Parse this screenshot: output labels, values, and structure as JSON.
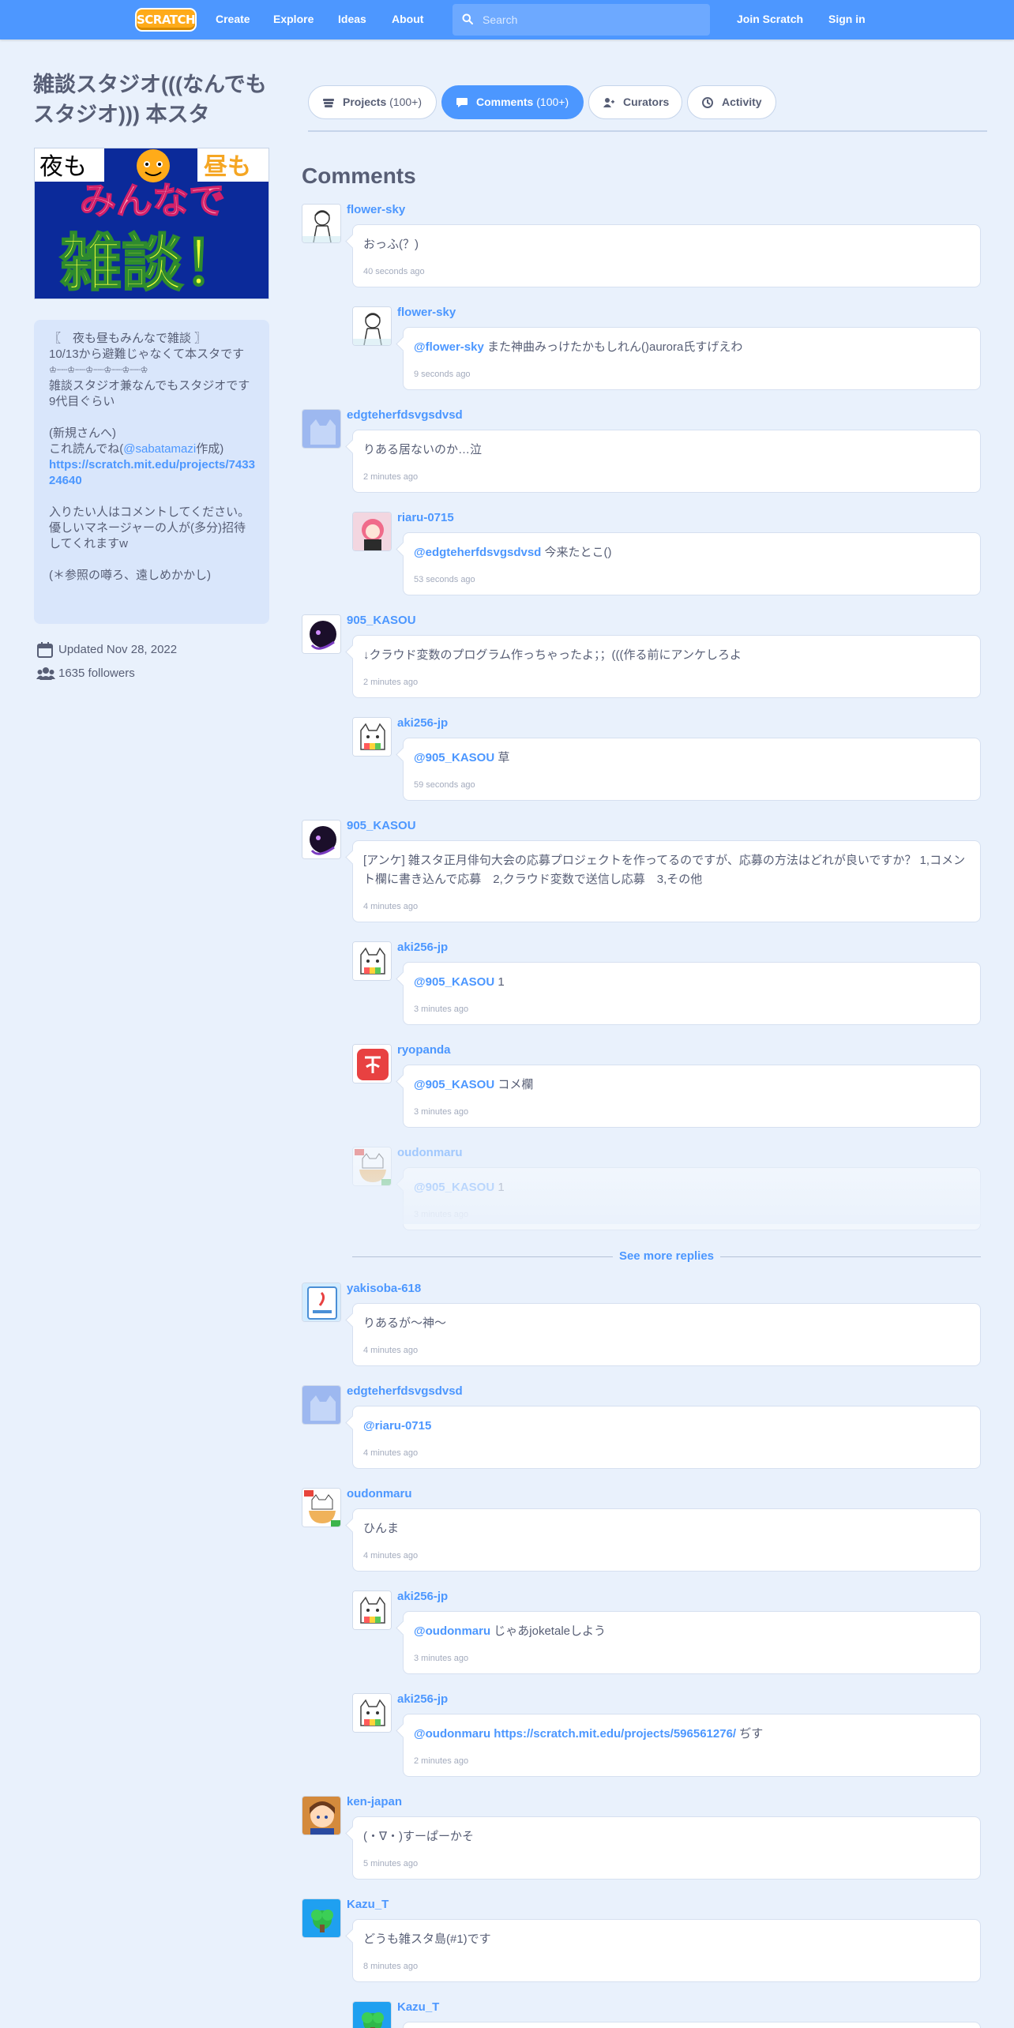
{
  "nav": {
    "logo": "SCRATCH",
    "links": [
      "Create",
      "Explore",
      "Ideas",
      "About"
    ],
    "search_placeholder": "Search",
    "join": "Join Scratch",
    "signin": "Sign in"
  },
  "studio": {
    "title": "雑談スタジオ(((なんでもスタジオ))) 本スタ",
    "thumbnail": {
      "top_left": "夜も",
      "top_right": "昼も",
      "middle": "みんなで",
      "bottom": "雑談！"
    },
    "description_lines": [
      "〖　夜も昼もみんなで雑談 〗",
      "10/13から避難じゃなくて本スタです",
      "♔┈┈♔┈┈♔┈┈♔┈┈♔┈┈♔",
      "雑談スタジオ兼なんでもスタジオです",
      "9代目ぐらい",
      "",
      "(新規さんへ)"
    ],
    "description_read_pre": "これ読んでね(",
    "description_read_mention": "@sabatamazi",
    "description_read_post": "作成)",
    "description_link": "https://scratch.mit.edu/projects/743324640",
    "description_lines_after": [
      "",
      "入りたい人はコメントしてください。",
      "優しいマネージャーの人が(多分)招待してくれますw",
      "",
      "(＊参照の噂ろ、遠しめかかし)"
    ],
    "updated": "Updated Nov 28, 2022",
    "followers": "1635 followers"
  },
  "tabs": [
    {
      "label": "Projects",
      "count": "(100+)"
    },
    {
      "label": "Comments",
      "count": "(100+)"
    },
    {
      "label": "Curators",
      "count": ""
    },
    {
      "label": "Activity",
      "count": ""
    }
  ],
  "comments_heading": "Comments",
  "see_more": "See more replies",
  "colors": {
    "nav": "#4d97ff",
    "link": "#4c97ff",
    "background": "#e9f1fc",
    "text": "#575e75"
  },
  "comments": [
    {
      "user": "flower-sky",
      "mention": "",
      "text": "おっふ(？)",
      "time": "40 seconds ago",
      "avatar": "sketch-girl"
    },
    {
      "user": "flower-sky",
      "mention": "@flower-sky",
      "text": " また神曲みっけたかもしれん()aurora氏すげえわ",
      "time": "9 seconds ago",
      "avatar": "sketch-girl"
    },
    {
      "user": "edgteherfdsvgsdvsd",
      "mention": "",
      "text": "りある居ないのか…泣",
      "time": "2 minutes ago",
      "avatar": "default-cat"
    },
    {
      "user": "riaru-0715",
      "mention": "@edgteherfdsvgsdvsd",
      "text": " 今来たとこ()",
      "time": "53 seconds ago",
      "avatar": "pink-hair"
    },
    {
      "user": "905_KASOU",
      "mention": "",
      "text": "↓クラウド変数のプログラム作っちゃったよ；；(((作る前にアンケしろよ",
      "time": "2 minutes ago",
      "avatar": "dark-ghost"
    },
    {
      "user": "aki256-jp",
      "mention": "@905_KASOU",
      "text": " 草",
      "time": "59 seconds ago",
      "avatar": "white-cat"
    },
    {
      "user": "905_KASOU",
      "mention": "",
      "text": "[アンケ] 雑スタ正月俳句大会の応募プロジェクトを作ってるのですが、応募の方法はどれが良いですか？ 1,コメント欄に書き込んで応募　2,クラウド変数で送信し応募　3,その他",
      "time": "4 minutes ago",
      "avatar": "dark-ghost"
    },
    {
      "user": "aki256-jp",
      "mention": "@905_KASOU",
      "text": " 1",
      "time": "3 minutes ago",
      "avatar": "white-cat"
    },
    {
      "user": "ryopanda",
      "mention": "@905_KASOU",
      "text": " コメ欄",
      "time": "3 minutes ago",
      "avatar": "red-logo"
    },
    {
      "user": "oudonmaru",
      "mention": "@905_KASOU",
      "text": " 1",
      "time": "3 minutes ago",
      "avatar": "bowl-cat"
    },
    {
      "user": "yakisoba-618",
      "mention": "",
      "text": "りあるが～神～",
      "time": "4 minutes ago",
      "avatar": "blue-card"
    },
    {
      "user": "edgteherfdsvgsdvsd",
      "mention": "@riaru-0715",
      "text": "",
      "time": "4 minutes ago",
      "avatar": "default-cat"
    },
    {
      "user": "oudonmaru",
      "mention": "",
      "text": "ひんま",
      "time": "4 minutes ago",
      "avatar": "bowl-cat"
    },
    {
      "user": "aki256-jp",
      "mention": "@oudonmaru",
      "text": " じゃあjoketaleしよう",
      "time": "3 minutes ago",
      "avatar": "white-cat"
    },
    {
      "user": "aki256-jp",
      "mention": "@oudonmaru",
      "link": " https://scratch.mit.edu/projects/596561276/",
      "text": " ぢす",
      "time": "2 minutes ago",
      "avatar": "white-cat"
    },
    {
      "user": "ken-japan",
      "mention": "",
      "text": "(・∇・)すーぱーかそ",
      "time": "5 minutes ago",
      "avatar": "anime-boy"
    },
    {
      "user": "Kazu_T",
      "mention": "",
      "text": "どうも雑スタ島(#1)です",
      "time": "8 minutes ago",
      "avatar": "green-island"
    },
    {
      "user": "Kazu_T",
      "mention": "",
      "text": "",
      "time": "",
      "avatar": "green-island"
    }
  ]
}
